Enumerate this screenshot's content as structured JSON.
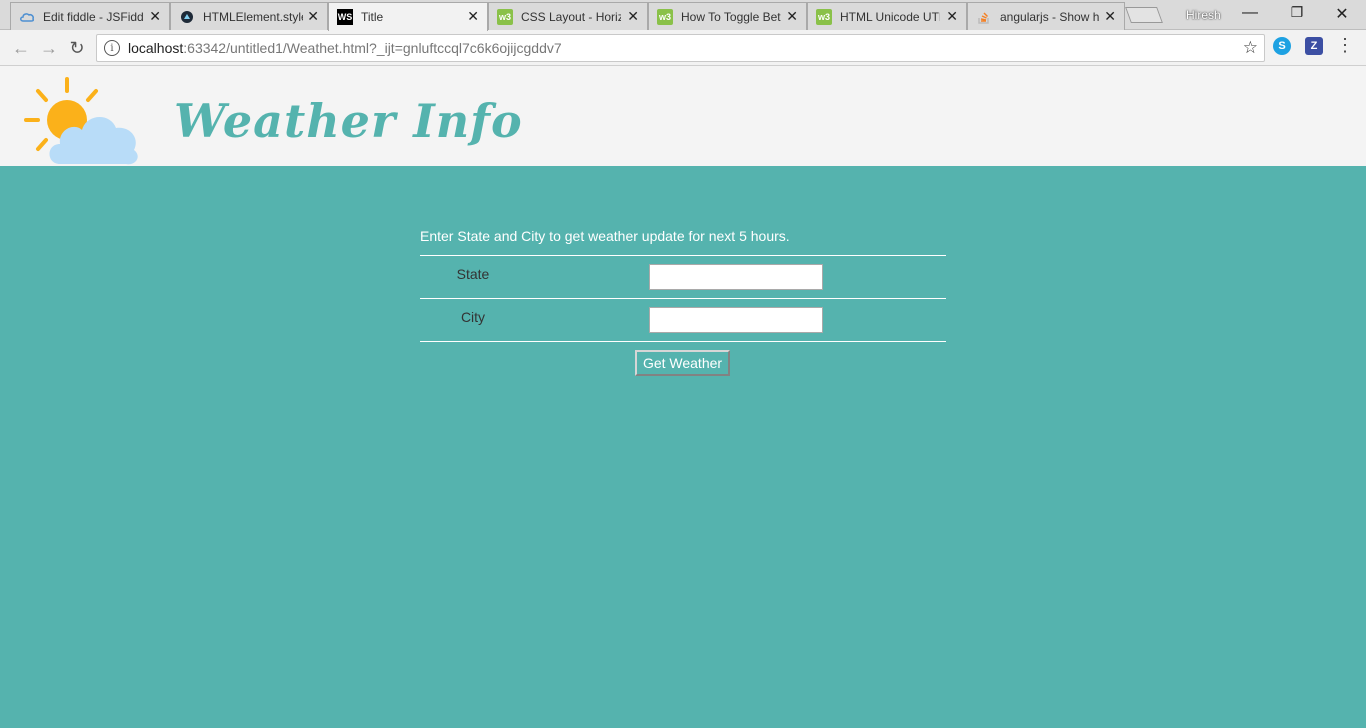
{
  "browser": {
    "tabs": [
      {
        "title": "Edit fiddle - JSFiddl",
        "icon": "jsfiddle-icon",
        "active": false
      },
      {
        "title": "HTMLElement.style",
        "icon": "mdn-icon",
        "active": false
      },
      {
        "title": "Title",
        "icon": "webstorm-icon",
        "active": true
      },
      {
        "title": "CSS Layout - Horiz",
        "icon": "w3schools-icon",
        "active": false
      },
      {
        "title": "How To Toggle Bet",
        "icon": "w3schools-icon",
        "active": false
      },
      {
        "title": "HTML Unicode UTF",
        "icon": "w3schools-icon",
        "active": false
      },
      {
        "title": "angularjs - Show h",
        "icon": "stackoverflow-icon",
        "active": false
      }
    ],
    "close_glyph": "✕",
    "profile_name": "Hiresh",
    "window_controls": {
      "minimize": "—",
      "restore": "❐",
      "close": "✕"
    },
    "nav": {
      "back": "←",
      "forward": "→",
      "reload": "↻"
    },
    "url_host": "localhost",
    "url_rest": ":63342/untitled1/Weathet.html?_ijt=gnluftccql7c6k6ojijcgddv7",
    "info_glyph": "i",
    "star_glyph": "☆",
    "extensions": [
      {
        "name": "skype-icon",
        "glyph": "S",
        "color": "#1da1e2"
      },
      {
        "name": "zotero-icon",
        "glyph": "Z",
        "color": "#3c4fa3"
      }
    ],
    "menu_glyph": "⋮"
  },
  "header": {
    "title": "Weather Info"
  },
  "form": {
    "intro": "Enter State and City to get weather update for next 5 hours.",
    "state_label": "State",
    "state_value": "",
    "city_label": "City",
    "city_value": "",
    "submit_label": "Get Weather"
  },
  "colors": {
    "accent": "#55b3ae",
    "header_bg": "#f4f4f4",
    "sun": "#fbb11a",
    "cloud": "#b8dcf8"
  }
}
